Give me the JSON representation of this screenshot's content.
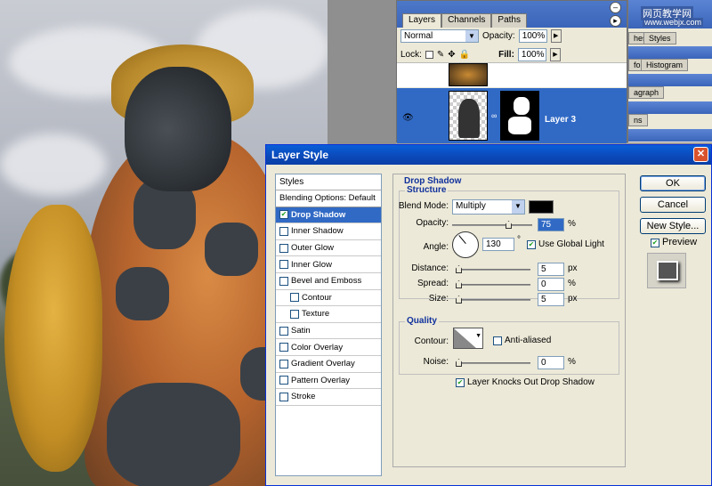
{
  "layers_panel": {
    "tabs": [
      "Layers",
      "Channels",
      "Paths"
    ],
    "blend_mode": "Normal",
    "opacity_label": "Opacity:",
    "opacity_value": "100%",
    "lock_label": "Lock:",
    "fill_label": "Fill:",
    "fill_value": "100%",
    "layer_name": "Layer 3"
  },
  "right_panels": {
    "tabs_top": [
      "hes",
      "Styles"
    ],
    "tab_info": "fo",
    "tab_histogram": "Histogram",
    "tab_paragraph": "agraph",
    "tab_actions": "ns",
    "watermark_line1": "网页教学网",
    "watermark_line2": "www.webjx.com"
  },
  "dialog": {
    "title": "Layer Style",
    "styles_header": "Styles",
    "blending_options": "Blending Options: Default",
    "effects": [
      {
        "label": "Drop Shadow",
        "checked": true,
        "active": true,
        "indent": false
      },
      {
        "label": "Inner Shadow",
        "checked": false,
        "active": false,
        "indent": false
      },
      {
        "label": "Outer Glow",
        "checked": false,
        "active": false,
        "indent": false
      },
      {
        "label": "Inner Glow",
        "checked": false,
        "active": false,
        "indent": false
      },
      {
        "label": "Bevel and Emboss",
        "checked": false,
        "active": false,
        "indent": false
      },
      {
        "label": "Contour",
        "checked": false,
        "active": false,
        "indent": true
      },
      {
        "label": "Texture",
        "checked": false,
        "active": false,
        "indent": true
      },
      {
        "label": "Satin",
        "checked": false,
        "active": false,
        "indent": false
      },
      {
        "label": "Color Overlay",
        "checked": false,
        "active": false,
        "indent": false
      },
      {
        "label": "Gradient Overlay",
        "checked": false,
        "active": false,
        "indent": false
      },
      {
        "label": "Pattern Overlay",
        "checked": false,
        "active": false,
        "indent": false
      },
      {
        "label": "Stroke",
        "checked": false,
        "active": false,
        "indent": false
      }
    ],
    "section_title": "Drop Shadow",
    "structure_legend": "Structure",
    "blend_mode_label": "Blend Mode:",
    "blend_mode_value": "Multiply",
    "shadow_color": "#000000",
    "opacity_label": "Opacity:",
    "opacity_value": "75",
    "percent": "%",
    "angle_label": "Angle:",
    "angle_value": "130",
    "degree": "°",
    "use_global_light": "Use Global Light",
    "distance_label": "Distance:",
    "distance_value": "5",
    "spread_label": "Spread:",
    "spread_value": "0",
    "size_label": "Size:",
    "size_value": "5",
    "px": "px",
    "quality_legend": "Quality",
    "contour_label": "Contour:",
    "anti_aliased": "Anti-aliased",
    "noise_label": "Noise:",
    "noise_value": "0",
    "knockout": "Layer Knocks Out Drop Shadow",
    "ok": "OK",
    "cancel": "Cancel",
    "new_style": "New Style...",
    "preview": "Preview"
  }
}
